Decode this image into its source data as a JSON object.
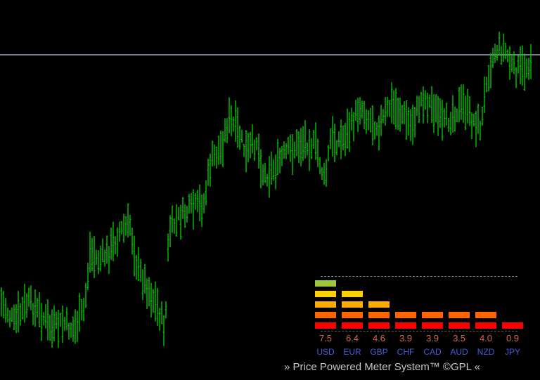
{
  "chart_data": {
    "type": "bar",
    "subtype": "ohlc-price-bars",
    "bar_color": "#00d400",
    "background": "#000000",
    "horizontal_line_color": "#9aa7b8",
    "grid": false,
    "meter": {
      "categories": [
        "USD",
        "EUR",
        "GBP",
        "CHF",
        "CAD",
        "AUD",
        "NZD",
        "JPY"
      ],
      "values": [
        "7.5",
        "6.4",
        "4.6",
        "3.9",
        "3.9",
        "3.5",
        "4.0",
        "0.9"
      ],
      "levels": [
        5,
        4,
        3,
        2,
        2,
        2,
        2,
        1
      ],
      "level_colors": [
        "#ff0000",
        "#ff6600",
        "#ffaa00",
        "#ffd000",
        "#9bc83a",
        "#00ff00"
      ]
    }
  },
  "footer": {
    "text": "» Price Powered Meter System™ ©GPL «"
  }
}
